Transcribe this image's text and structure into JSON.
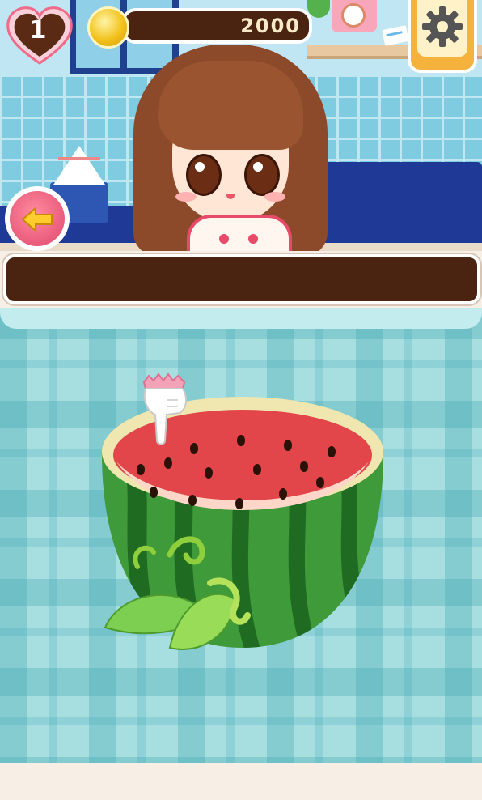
{
  "hud": {
    "lives": "1",
    "coins": "2000"
  },
  "progress": {
    "fill_fraction": 0.0
  },
  "icons": {
    "heart": "heart-icon",
    "coin": "coin-icon",
    "settings": "gear-icon",
    "back": "back-arrow-icon",
    "pointer": "pointing-hand-icon",
    "watermelon": "watermelon-bowl-icon"
  },
  "colors": {
    "heart_fill": "#5a2a14",
    "heart_outline": "#f06a8a",
    "progress_bar": "#4a2410",
    "settings_bg": "#f5b23c",
    "back_button": "#e0486b",
    "watermelon_flesh": "#e2454a",
    "watermelon_rind": "#3f9a3a"
  }
}
